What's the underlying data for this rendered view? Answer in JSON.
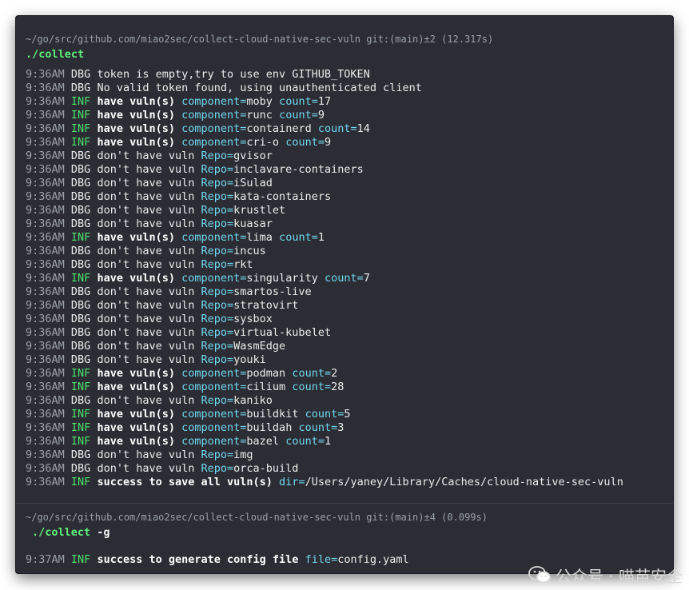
{
  "session1": {
    "prompt": "~/go/src/github.com/miao2sec/collect-cloud-native-sec-vuln git:(main)±2 (12.317s)",
    "command": "./collect",
    "args": "",
    "lines": [
      {
        "time": "9:36AM",
        "level": "DBG",
        "bold": false,
        "msg": "token is empty,try to use env GITHUB_TOKEN",
        "fields": []
      },
      {
        "time": "9:36AM",
        "level": "DBG",
        "bold": false,
        "msg": "No valid token found, using unauthenticated client",
        "fields": []
      },
      {
        "time": "9:36AM",
        "level": "INF",
        "bold": true,
        "msg": "have vuln(s)",
        "fields": [
          {
            "k": "component",
            "v": "moby"
          },
          {
            "k": "count",
            "v": "17"
          }
        ]
      },
      {
        "time": "9:36AM",
        "level": "INF",
        "bold": true,
        "msg": "have vuln(s)",
        "fields": [
          {
            "k": "component",
            "v": "runc"
          },
          {
            "k": "count",
            "v": "9"
          }
        ]
      },
      {
        "time": "9:36AM",
        "level": "INF",
        "bold": true,
        "msg": "have vuln(s)",
        "fields": [
          {
            "k": "component",
            "v": "containerd"
          },
          {
            "k": "count",
            "v": "14"
          }
        ]
      },
      {
        "time": "9:36AM",
        "level": "INF",
        "bold": true,
        "msg": "have vuln(s)",
        "fields": [
          {
            "k": "component",
            "v": "cri-o"
          },
          {
            "k": "count",
            "v": "9"
          }
        ]
      },
      {
        "time": "9:36AM",
        "level": "DBG",
        "bold": false,
        "msg": "don't have vuln",
        "fields": [
          {
            "k": "Repo",
            "v": "gvisor"
          }
        ]
      },
      {
        "time": "9:36AM",
        "level": "DBG",
        "bold": false,
        "msg": "don't have vuln",
        "fields": [
          {
            "k": "Repo",
            "v": "inclavare-containers"
          }
        ]
      },
      {
        "time": "9:36AM",
        "level": "DBG",
        "bold": false,
        "msg": "don't have vuln",
        "fields": [
          {
            "k": "Repo",
            "v": "iSulad"
          }
        ]
      },
      {
        "time": "9:36AM",
        "level": "DBG",
        "bold": false,
        "msg": "don't have vuln",
        "fields": [
          {
            "k": "Repo",
            "v": "kata-containers"
          }
        ]
      },
      {
        "time": "9:36AM",
        "level": "DBG",
        "bold": false,
        "msg": "don't have vuln",
        "fields": [
          {
            "k": "Repo",
            "v": "krustlet"
          }
        ]
      },
      {
        "time": "9:36AM",
        "level": "DBG",
        "bold": false,
        "msg": "don't have vuln",
        "fields": [
          {
            "k": "Repo",
            "v": "kuasar"
          }
        ]
      },
      {
        "time": "9:36AM",
        "level": "INF",
        "bold": true,
        "msg": "have vuln(s)",
        "fields": [
          {
            "k": "component",
            "v": "lima"
          },
          {
            "k": "count",
            "v": "1"
          }
        ]
      },
      {
        "time": "9:36AM",
        "level": "DBG",
        "bold": false,
        "msg": "don't have vuln",
        "fields": [
          {
            "k": "Repo",
            "v": "incus"
          }
        ]
      },
      {
        "time": "9:36AM",
        "level": "DBG",
        "bold": false,
        "msg": "don't have vuln",
        "fields": [
          {
            "k": "Repo",
            "v": "rkt"
          }
        ]
      },
      {
        "time": "9:36AM",
        "level": "INF",
        "bold": true,
        "msg": "have vuln(s)",
        "fields": [
          {
            "k": "component",
            "v": "singularity"
          },
          {
            "k": "count",
            "v": "7"
          }
        ]
      },
      {
        "time": "9:36AM",
        "level": "DBG",
        "bold": false,
        "msg": "don't have vuln",
        "fields": [
          {
            "k": "Repo",
            "v": "smartos-live"
          }
        ]
      },
      {
        "time": "9:36AM",
        "level": "DBG",
        "bold": false,
        "msg": "don't have vuln",
        "fields": [
          {
            "k": "Repo",
            "v": "stratovirt"
          }
        ]
      },
      {
        "time": "9:36AM",
        "level": "DBG",
        "bold": false,
        "msg": "don't have vuln",
        "fields": [
          {
            "k": "Repo",
            "v": "sysbox"
          }
        ]
      },
      {
        "time": "9:36AM",
        "level": "DBG",
        "bold": false,
        "msg": "don't have vuln",
        "fields": [
          {
            "k": "Repo",
            "v": "virtual-kubelet"
          }
        ]
      },
      {
        "time": "9:36AM",
        "level": "DBG",
        "bold": false,
        "msg": "don't have vuln",
        "fields": [
          {
            "k": "Repo",
            "v": "WasmEdge"
          }
        ]
      },
      {
        "time": "9:36AM",
        "level": "DBG",
        "bold": false,
        "msg": "don't have vuln",
        "fields": [
          {
            "k": "Repo",
            "v": "youki"
          }
        ]
      },
      {
        "time": "9:36AM",
        "level": "INF",
        "bold": true,
        "msg": "have vuln(s)",
        "fields": [
          {
            "k": "component",
            "v": "podman"
          },
          {
            "k": "count",
            "v": "2"
          }
        ]
      },
      {
        "time": "9:36AM",
        "level": "INF",
        "bold": true,
        "msg": "have vuln(s)",
        "fields": [
          {
            "k": "component",
            "v": "cilium"
          },
          {
            "k": "count",
            "v": "28"
          }
        ]
      },
      {
        "time": "9:36AM",
        "level": "DBG",
        "bold": false,
        "msg": "don't have vuln",
        "fields": [
          {
            "k": "Repo",
            "v": "kaniko"
          }
        ]
      },
      {
        "time": "9:36AM",
        "level": "INF",
        "bold": true,
        "msg": "have vuln(s)",
        "fields": [
          {
            "k": "component",
            "v": "buildkit"
          },
          {
            "k": "count",
            "v": "5"
          }
        ]
      },
      {
        "time": "9:36AM",
        "level": "INF",
        "bold": true,
        "msg": "have vuln(s)",
        "fields": [
          {
            "k": "component",
            "v": "buildah"
          },
          {
            "k": "count",
            "v": "3"
          }
        ]
      },
      {
        "time": "9:36AM",
        "level": "INF",
        "bold": true,
        "msg": "have vuln(s)",
        "fields": [
          {
            "k": "component",
            "v": "bazel"
          },
          {
            "k": "count",
            "v": "1"
          }
        ]
      },
      {
        "time": "9:36AM",
        "level": "DBG",
        "bold": false,
        "msg": "don't have vuln",
        "fields": [
          {
            "k": "Repo",
            "v": "img"
          }
        ]
      },
      {
        "time": "9:36AM",
        "level": "DBG",
        "bold": false,
        "msg": "don't have vuln",
        "fields": [
          {
            "k": "Repo",
            "v": "orca-build"
          }
        ]
      },
      {
        "time": "9:36AM",
        "level": "INF",
        "bold": true,
        "msg": "success to save all vuln(s)",
        "fields": [
          {
            "k": "dir",
            "v": "/Users/yaney/Library/Caches/cloud-native-sec-vuln"
          }
        ]
      }
    ]
  },
  "session2": {
    "prompt": "~/go/src/github.com/miao2sec/collect-cloud-native-sec-vuln git:(main)±4 (0.099s)",
    "command": "./collect",
    "args": " -g",
    "lines": [
      {
        "time": "9:37AM",
        "level": "INF",
        "bold": true,
        "msg": "success to generate config file",
        "fields": [
          {
            "k": "file",
            "v": "config.yaml"
          }
        ]
      }
    ]
  },
  "watermark": {
    "icon": "wechat-icon",
    "text": "公众号 · 喵苗安全"
  },
  "colors": {
    "background": "#2c2d34",
    "inf": "#4de26b",
    "key": "#6fd7f0",
    "command": "#5ef07a"
  }
}
